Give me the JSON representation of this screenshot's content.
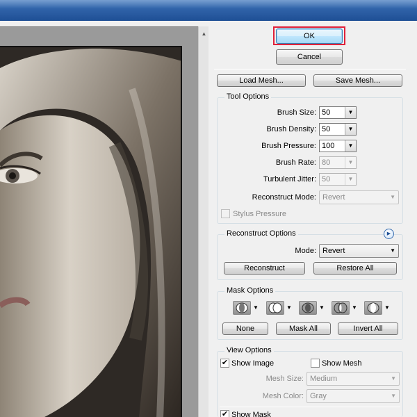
{
  "dialog": {
    "ok_label": "OK",
    "cancel_label": "Cancel",
    "load_mesh_label": "Load Mesh...",
    "save_mesh_label": "Save Mesh..."
  },
  "tool_options": {
    "title": "Tool Options",
    "brush_size": {
      "label": "Brush Size:",
      "value": "50"
    },
    "brush_density": {
      "label": "Brush Density:",
      "value": "50"
    },
    "brush_pressure": {
      "label": "Brush Pressure:",
      "value": "100"
    },
    "brush_rate": {
      "label": "Brush Rate:",
      "value": "80"
    },
    "turbulent_jitter": {
      "label": "Turbulent Jitter:",
      "value": "50"
    },
    "reconstruct_mode": {
      "label": "Reconstruct Mode:",
      "value": "Revert"
    },
    "stylus_pressure": {
      "label": "Stylus Pressure",
      "checked": false
    }
  },
  "reconstruct_options": {
    "title": "Reconstruct Options",
    "mode_label": "Mode:",
    "mode_value": "Revert",
    "reconstruct_label": "Reconstruct",
    "restore_all_label": "Restore All"
  },
  "mask_options": {
    "title": "Mask Options",
    "none_label": "None",
    "mask_all_label": "Mask All",
    "invert_all_label": "Invert All"
  },
  "view_options": {
    "title": "View Options",
    "show_image": {
      "label": "Show Image",
      "checked": true
    },
    "show_mesh": {
      "label": "Show Mesh",
      "checked": false
    },
    "mesh_size": {
      "label": "Mesh Size:",
      "value": "Medium"
    },
    "mesh_color": {
      "label": "Mesh Color:",
      "value": "Gray"
    },
    "show_mask": {
      "label": "Show Mask",
      "checked": true
    }
  },
  "glyphs": {
    "dropdown_arrow": "▼",
    "scroll_up_arrow": "▲",
    "info_arrow": "▶",
    "check_mark": "✔"
  },
  "colors": {
    "ok_highlight": "#e0213a",
    "titlebar": "#2f62a8"
  }
}
